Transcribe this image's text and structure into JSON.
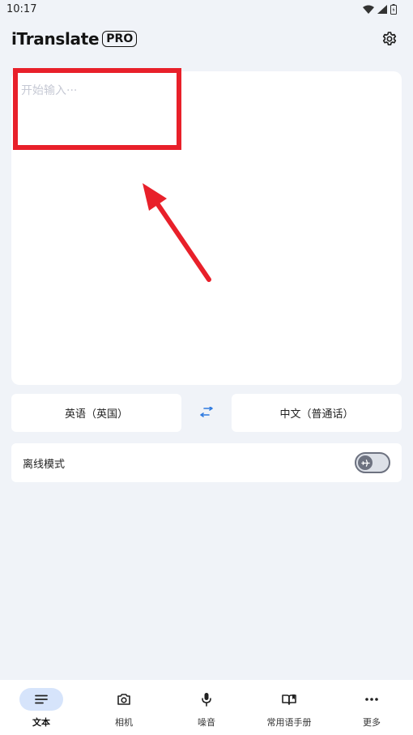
{
  "status_bar": {
    "time": "10:17",
    "icons": [
      "wifi-icon",
      "signal-icon",
      "battery-icon"
    ]
  },
  "header": {
    "title": "iTranslate",
    "badge": "PRO",
    "settings_icon": "gear-icon"
  },
  "input": {
    "placeholder": "开始输入···"
  },
  "languages": {
    "source": "英语（英国）",
    "target": "中文（普通话）",
    "swap_icon": "swap-arrows-icon"
  },
  "offline": {
    "label": "离线模式",
    "enabled": false
  },
  "nav": {
    "items": [
      {
        "label": "文本",
        "icon": "text-lines-icon",
        "active": true
      },
      {
        "label": "相机",
        "icon": "camera-icon",
        "active": false
      },
      {
        "label": "噪音",
        "icon": "microphone-icon",
        "active": false
      },
      {
        "label": "常用语手册",
        "icon": "phrasebook-icon",
        "active": false
      },
      {
        "label": "更多",
        "icon": "more-dots-icon",
        "active": false
      }
    ]
  },
  "colors": {
    "accent": "#2f7be0",
    "annotation": "#e8202a",
    "background": "#f0f3f8",
    "nav_active_pill": "#d6e4fb"
  }
}
